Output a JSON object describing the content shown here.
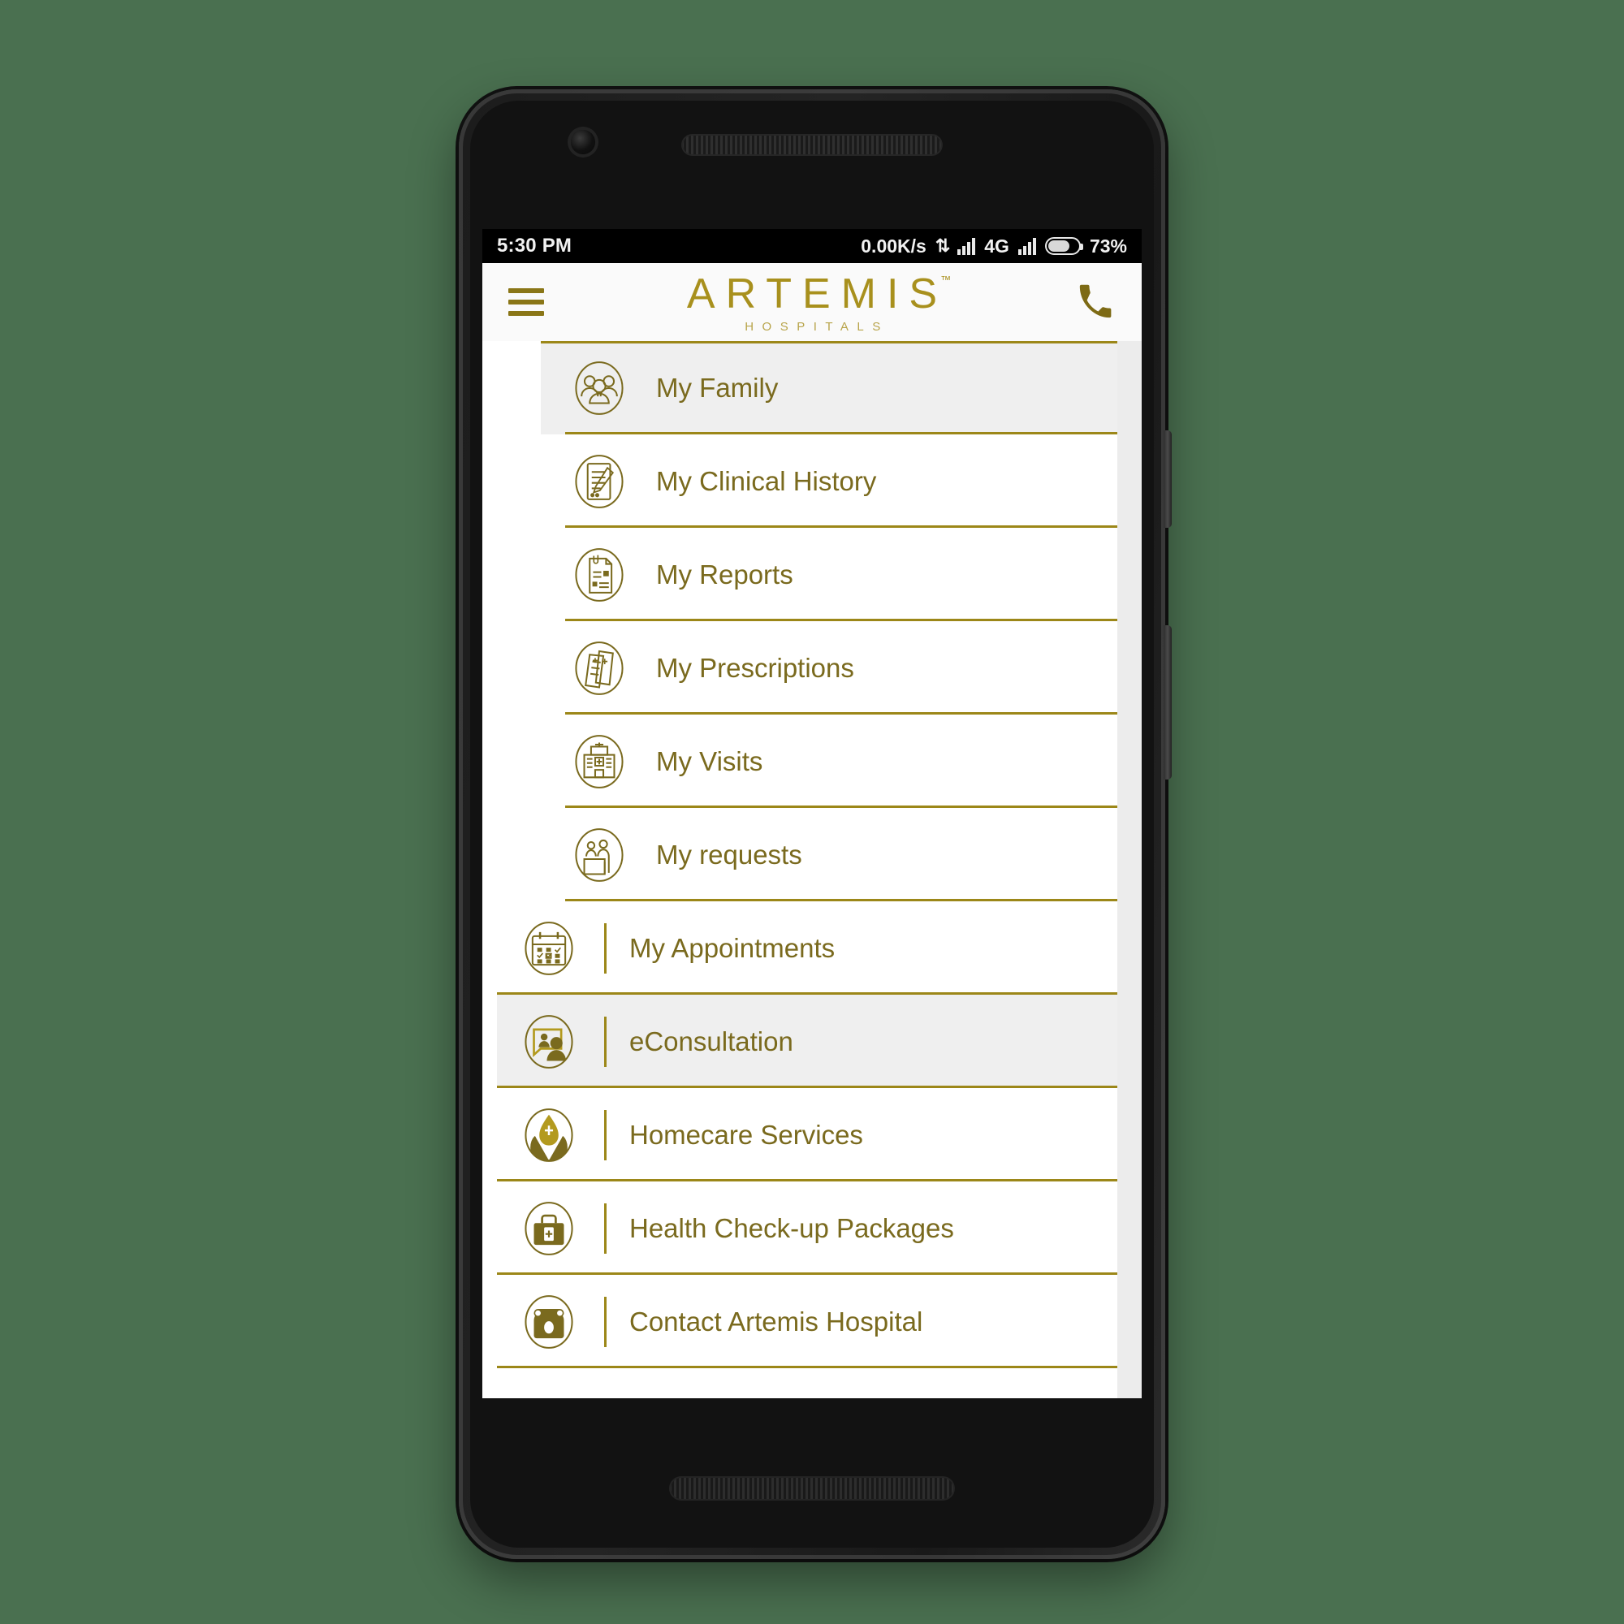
{
  "status_bar": {
    "clock": "5:30 PM",
    "network_speed": "0.00K/s",
    "transfer_icon": "data-transfer-arrows-icon",
    "network_type": "4G",
    "battery_percent": "73%",
    "battery_level": 73
  },
  "app_bar": {
    "menu_icon": "hamburger-menu-icon",
    "brand_name": "ARTEMIS",
    "brand_tm": "™",
    "brand_subtitle": "HOSPITALS",
    "call_icon": "phone-handset-icon"
  },
  "colors": {
    "gold": "#9c8718",
    "gold_text": "#7a6a1e",
    "brand_gold": "#a8901d",
    "active_row_bg": "#efefef",
    "page_bg": "#4a7050"
  },
  "menu": {
    "group_a": [
      {
        "label": "My Family",
        "icon": "family-group-icon",
        "active": true
      },
      {
        "label": "My Clinical History",
        "icon": "document-pen-icon",
        "active": false
      },
      {
        "label": "My Reports",
        "icon": "report-clip-icon",
        "active": false
      },
      {
        "label": "My Prescriptions",
        "icon": "prescriptions-icon",
        "active": false
      },
      {
        "label": "My Visits",
        "icon": "hospital-building-icon",
        "active": false
      },
      {
        "label": "My requests",
        "icon": "reception-desk-icon",
        "active": false
      }
    ],
    "group_b": [
      {
        "label": "My Appointments",
        "icon": "calendar-check-icon",
        "active": false
      },
      {
        "label": "eConsultation",
        "icon": "video-consult-icon",
        "active": true
      },
      {
        "label": "Homecare Services",
        "icon": "hands-home-care-icon",
        "active": false
      },
      {
        "label": "Health Check-up Packages",
        "icon": "medical-kit-icon",
        "active": false
      },
      {
        "label": "Contact Artemis Hospital",
        "icon": "rotary-phone-icon",
        "active": false
      }
    ]
  }
}
